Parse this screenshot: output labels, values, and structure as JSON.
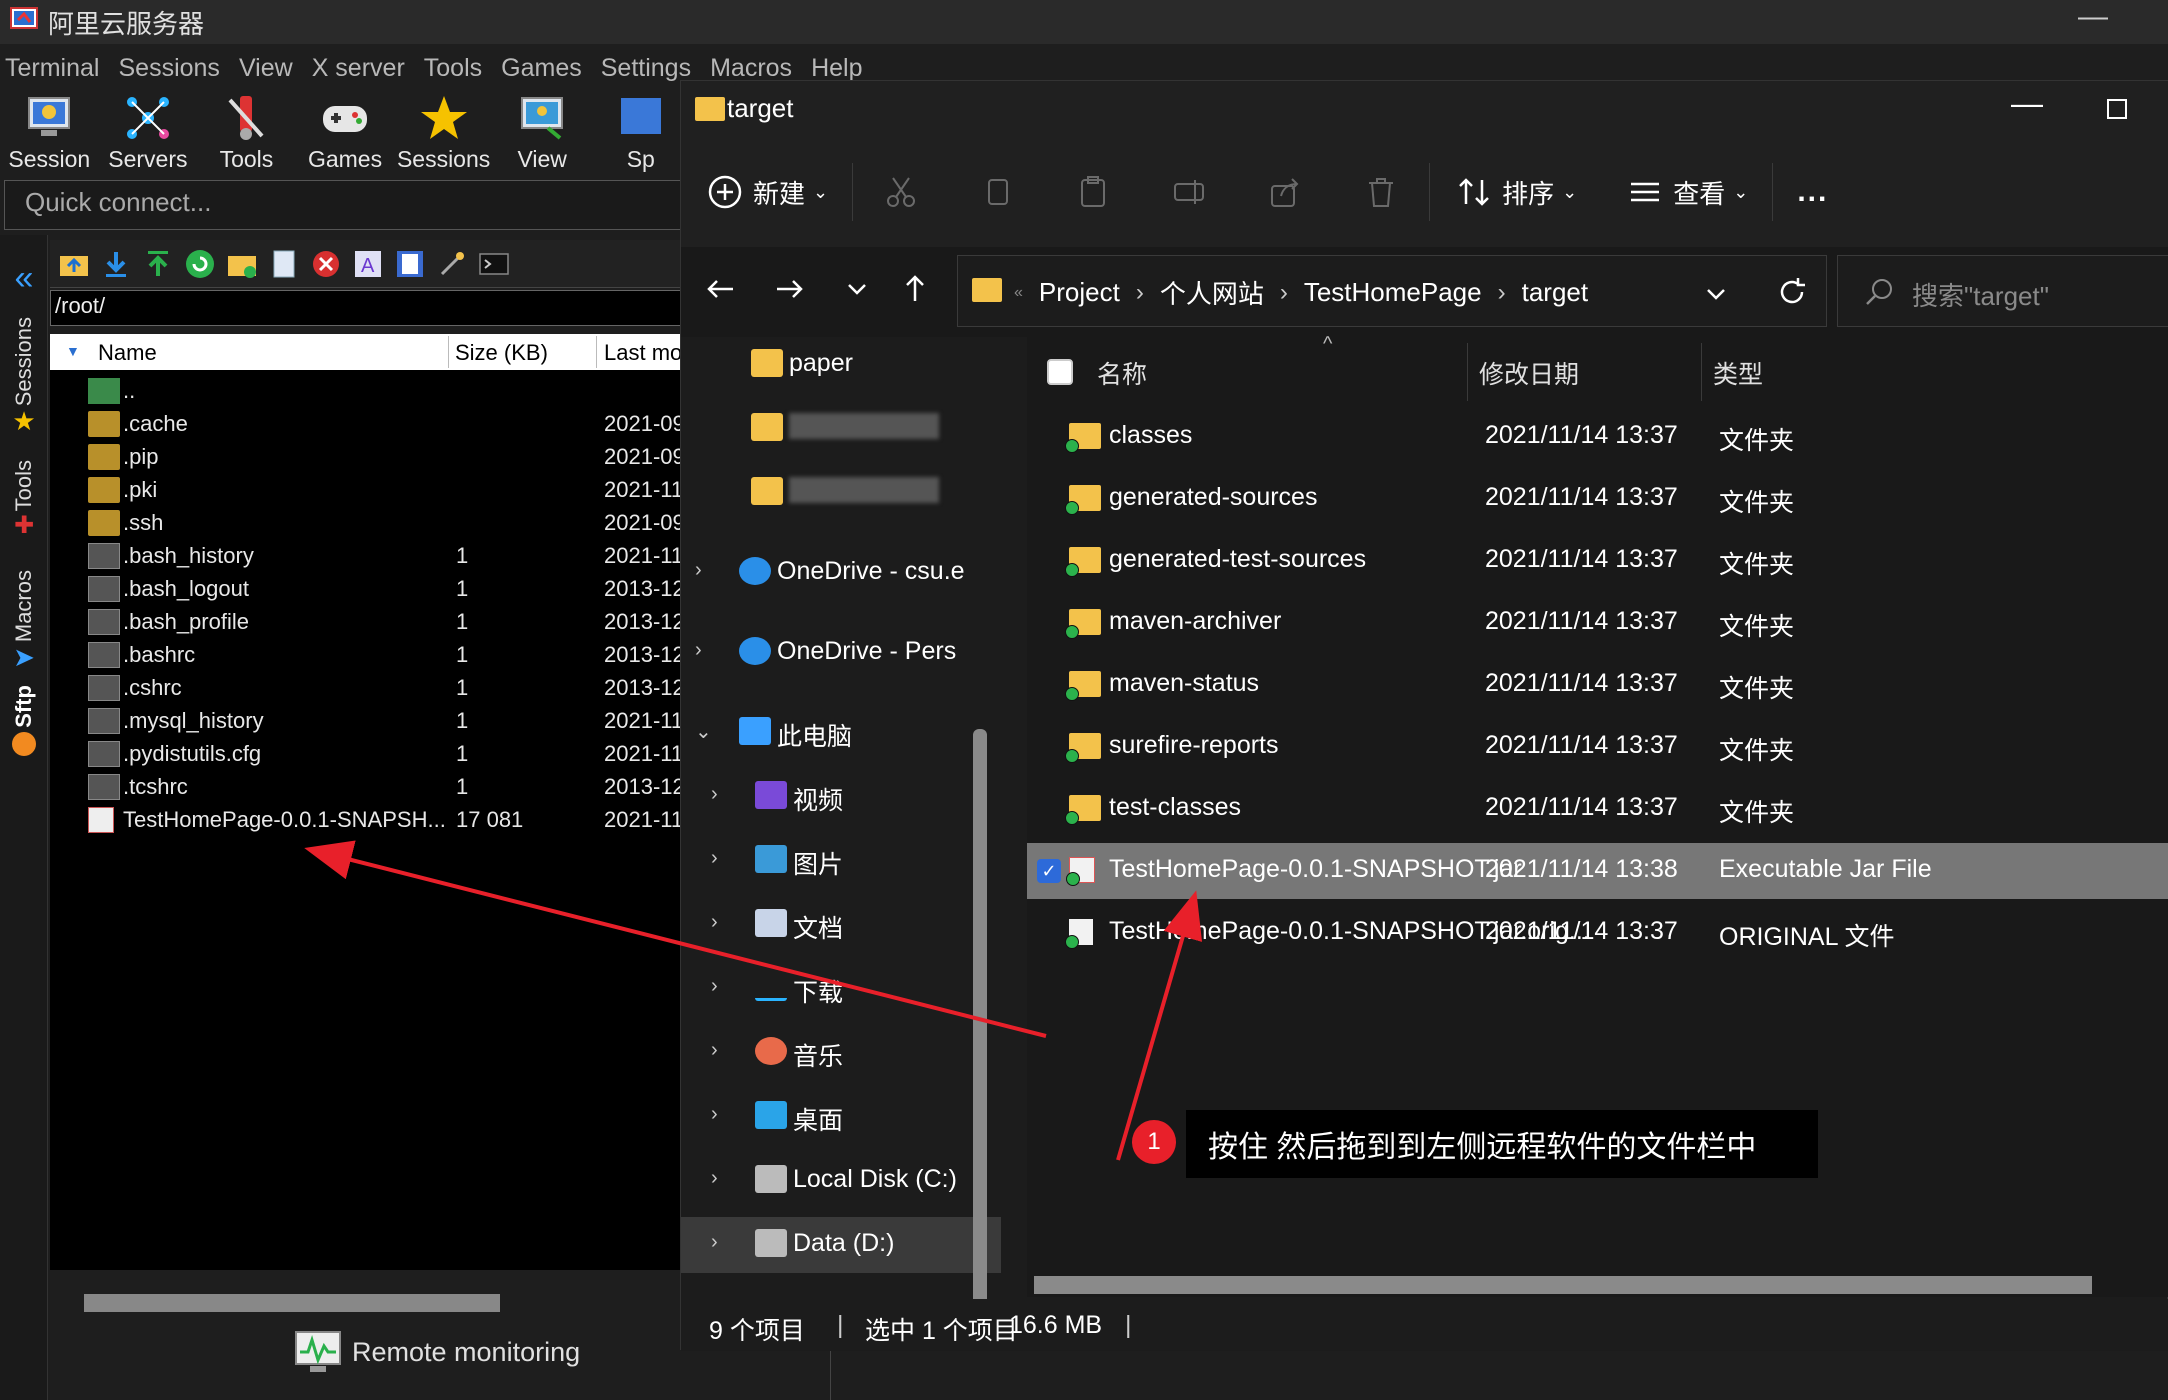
{
  "moba": {
    "title": "阿里云服务器",
    "menu": [
      "Terminal",
      "Sessions",
      "View",
      "X server",
      "Tools",
      "Games",
      "Settings",
      "Macros",
      "Help"
    ],
    "toolbar": [
      {
        "label": "Session",
        "icon": "session-icon"
      },
      {
        "label": "Servers",
        "icon": "servers-icon"
      },
      {
        "label": "Tools",
        "icon": "tools-icon"
      },
      {
        "label": "Games",
        "icon": "games-icon"
      },
      {
        "label": "Sessions",
        "icon": "sessions-star-icon"
      },
      {
        "label": "View",
        "icon": "view-icon"
      },
      {
        "label": "Sp",
        "icon": "split-icon"
      }
    ],
    "quick_connect_placeholder": "Quick connect...",
    "side_tabs": [
      "Sessions",
      "Tools",
      "Macros",
      "Sftp"
    ],
    "sftp_path": "/root/",
    "file_columns": [
      "Name",
      "Size (KB)",
      "Last mo"
    ],
    "files": [
      {
        "name": "..",
        "size": "",
        "date": "",
        "type": "parent"
      },
      {
        "name": ".cache",
        "size": "",
        "date": "2021-09",
        "type": "folder"
      },
      {
        "name": ".pip",
        "size": "",
        "date": "2021-09",
        "type": "folder"
      },
      {
        "name": ".pki",
        "size": "",
        "date": "2021-11",
        "type": "folder"
      },
      {
        "name": ".ssh",
        "size": "",
        "date": "2021-09",
        "type": "folder"
      },
      {
        "name": ".bash_history",
        "size": "1",
        "date": "2021-11",
        "type": "file"
      },
      {
        "name": ".bash_logout",
        "size": "1",
        "date": "2013-12",
        "type": "file"
      },
      {
        "name": ".bash_profile",
        "size": "1",
        "date": "2013-12",
        "type": "file"
      },
      {
        "name": ".bashrc",
        "size": "1",
        "date": "2013-12",
        "type": "file"
      },
      {
        "name": ".cshrc",
        "size": "1",
        "date": "2013-12",
        "type": "file"
      },
      {
        "name": ".mysql_history",
        "size": "1",
        "date": "2021-11",
        "type": "file"
      },
      {
        "name": ".pydistutils.cfg",
        "size": "1",
        "date": "2021-11",
        "type": "file"
      },
      {
        "name": ".tcshrc",
        "size": "1",
        "date": "2013-12",
        "type": "file"
      },
      {
        "name": "TestHomePage-0.0.1-SNAPSH...",
        "size": "17 081",
        "date": "2021-11",
        "type": "jar"
      }
    ],
    "remote_monitoring": "Remote monitoring"
  },
  "explorer": {
    "title": "target",
    "cmd": {
      "new": "新建",
      "sort": "排序",
      "view": "查看",
      "more": "..."
    },
    "breadcrumbs": [
      "Project",
      "个人网站",
      "TestHomePage",
      "target"
    ],
    "search_placeholder": "搜索\"target\"",
    "nav": [
      {
        "label": "paper",
        "icon": "folder-icon",
        "chev": ""
      },
      {
        "label": "",
        "icon": "folder-icon",
        "chev": ""
      },
      {
        "label": "",
        "icon": "folder-icon",
        "chev": ""
      },
      {
        "label": "OneDrive - csu.e",
        "icon": "onedrive-icon",
        "chev": "›"
      },
      {
        "label": "OneDrive - Pers",
        "icon": "onedrive-icon",
        "chev": "›"
      },
      {
        "label": "此电脑",
        "icon": "this-pc-icon",
        "chev": "⌄"
      },
      {
        "label": "视频",
        "icon": "video-icon",
        "chev": "›"
      },
      {
        "label": "图片",
        "icon": "pictures-icon",
        "chev": "›"
      },
      {
        "label": "文档",
        "icon": "documents-icon",
        "chev": "›"
      },
      {
        "label": "下载",
        "icon": "downloads-icon",
        "chev": "›"
      },
      {
        "label": "音乐",
        "icon": "music-icon",
        "chev": "›"
      },
      {
        "label": "桌面",
        "icon": "desktop-icon",
        "chev": "›"
      },
      {
        "label": "Local Disk (C:)",
        "icon": "drive-icon",
        "chev": "›"
      },
      {
        "label": "Data (D:)",
        "icon": "drive-icon",
        "chev": "›"
      }
    ],
    "columns": [
      "名称",
      "修改日期",
      "类型"
    ],
    "rows": [
      {
        "name": "classes",
        "date": "2021/11/14 13:37",
        "type": "文件夹",
        "kind": "folder"
      },
      {
        "name": "generated-sources",
        "date": "2021/11/14 13:37",
        "type": "文件夹",
        "kind": "folder"
      },
      {
        "name": "generated-test-sources",
        "date": "2021/11/14 13:37",
        "type": "文件夹",
        "kind": "folder"
      },
      {
        "name": "maven-archiver",
        "date": "2021/11/14 13:37",
        "type": "文件夹",
        "kind": "folder"
      },
      {
        "name": "maven-status",
        "date": "2021/11/14 13:37",
        "type": "文件夹",
        "kind": "folder"
      },
      {
        "name": "surefire-reports",
        "date": "2021/11/14 13:37",
        "type": "文件夹",
        "kind": "folder"
      },
      {
        "name": "test-classes",
        "date": "2021/11/14 13:37",
        "type": "文件夹",
        "kind": "folder"
      },
      {
        "name": "TestHomePage-0.0.1-SNAPSHOT.jar",
        "date": "2021/11/14 13:38",
        "type": "Executable Jar File",
        "kind": "jar",
        "selected": true
      },
      {
        "name": "TestHomePage-0.0.1-SNAPSHOT.jar.orig...",
        "date": "2021/11/14 13:37",
        "type": "ORIGINAL 文件",
        "kind": "file"
      }
    ],
    "status": {
      "count": "9 个项目",
      "selected": "选中 1 个项目",
      "size": "16.6 MB"
    }
  },
  "annotation": {
    "number": "1",
    "text": "按住 然后拖到到左侧远程软件的文件栏中",
    "color": "#e8202a"
  }
}
